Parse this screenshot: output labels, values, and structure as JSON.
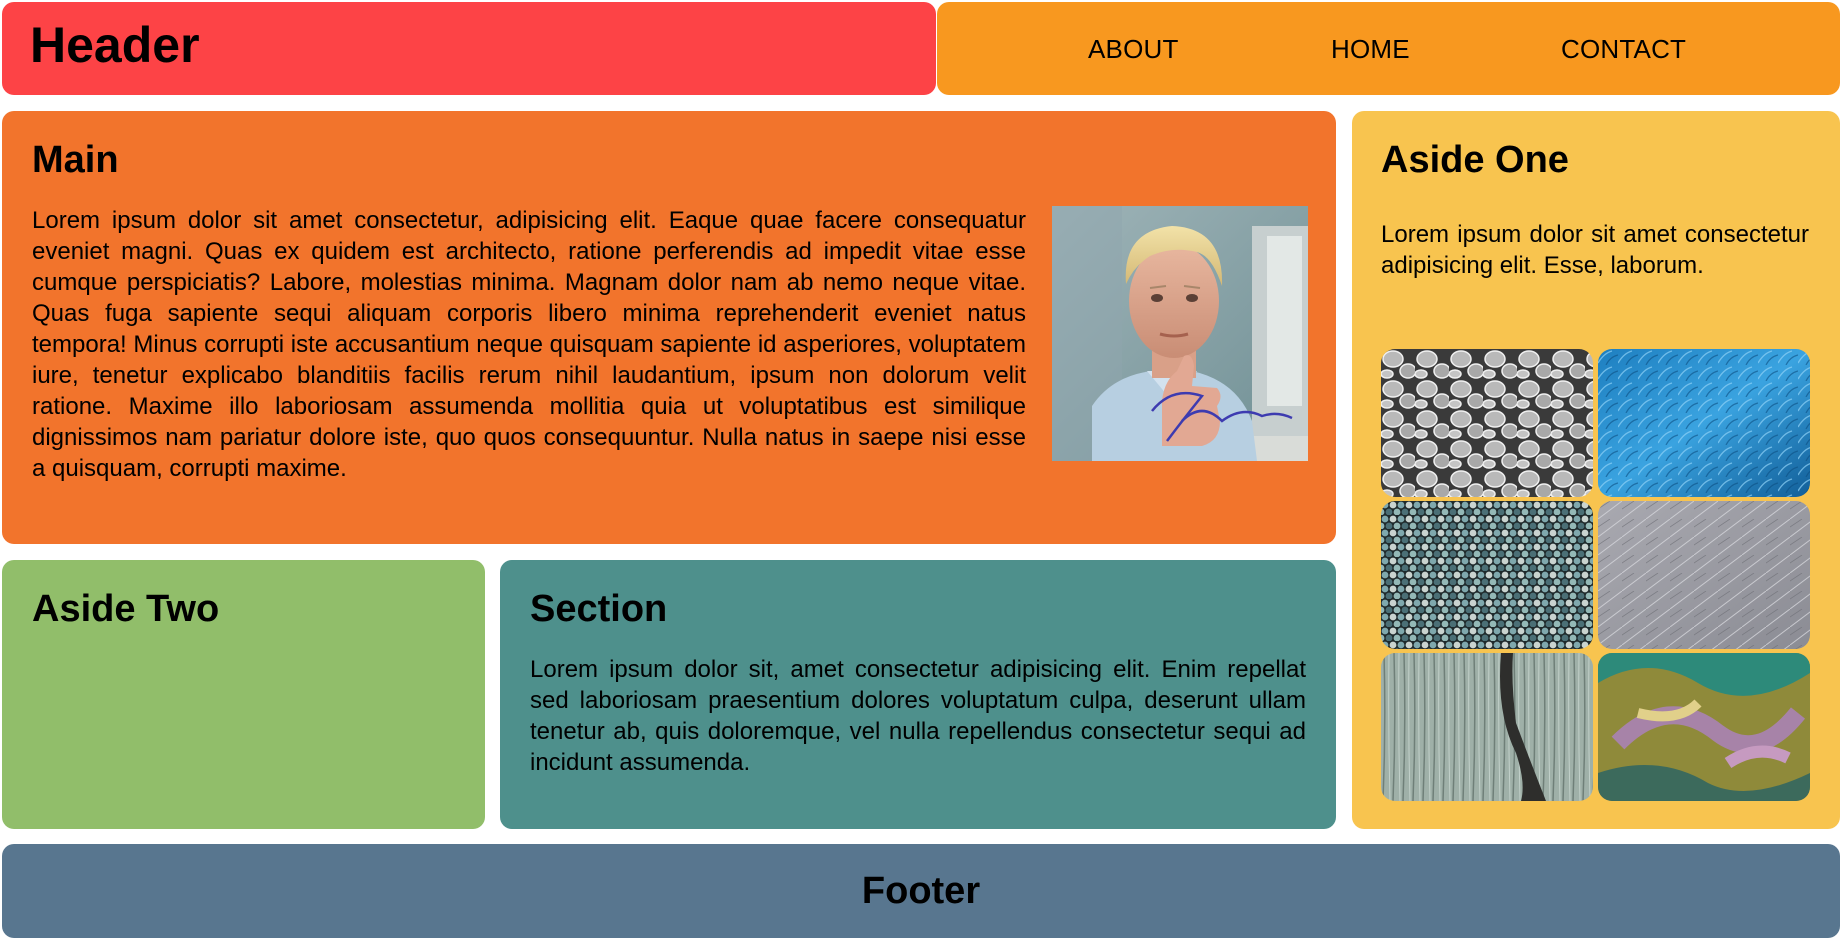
{
  "colors": {
    "header": "#fd4346",
    "nav": "#f8981f",
    "main": "#f2742c",
    "aside_one": "#f8c44f",
    "aside_two": "#91be6a",
    "section": "#4e908c",
    "footer": "#58768f"
  },
  "header": {
    "title": "Header"
  },
  "nav": {
    "items": [
      {
        "label": "ABOUT"
      },
      {
        "label": "HOME"
      },
      {
        "label": "CONTACT"
      }
    ]
  },
  "main": {
    "title": "Main",
    "text": "Lorem ipsum dolor sit amet consectetur, adipisicing elit. Eaque quae facere consequatur eveniet magni. Quas ex quidem est architecto, ratione perferendis ad impedit vitae esse cumque perspiciatis? Labore, molestias minima. Magnam dolor nam ab nemo neque vitae. Quas fuga sapiente sequi aliquam corporis libero minima reprehenderit eveniet natus tempora! Minus corrupti iste accusantium neque quisquam sapiente id asperiores, voluptatem iure, tenetur explicabo blanditiis facilis rerum nihil laudantium, ipsum non dolorum velit ratione. Maxime illo laboriosam assumenda mollitia quia ut voluptatibus est similique dignissimos nam pariatur dolore iste, quo quos consequuntur. Nulla natus in saepe nisi esse a quisquam, corrupti maxime.",
    "photo_signature": "Brent Rambo"
  },
  "aside_one": {
    "title": "Aside One",
    "text": "Lorem ipsum dolor sit amet consectetur adipisicing elit. Esse, laborum.",
    "tiles": [
      {
        "texture": "grey-pebble-cells"
      },
      {
        "texture": "blue-fur"
      },
      {
        "texture": "teal-mosaic"
      },
      {
        "texture": "grey-scratched"
      },
      {
        "texture": "weathered-wood"
      },
      {
        "texture": "swirled-paint"
      }
    ]
  },
  "aside_two": {
    "title": "Aside Two"
  },
  "section": {
    "title": "Section",
    "text": "Lorem ipsum dolor sit, amet consectetur adipisicing elit. Enim repellat sed laboriosam praesentium dolores voluptatum culpa, deserunt ullam tenetur ab, quis doloremque, vel nulla repellendus consectetur sequi ad incidunt assumenda."
  },
  "footer": {
    "title": "Footer"
  }
}
